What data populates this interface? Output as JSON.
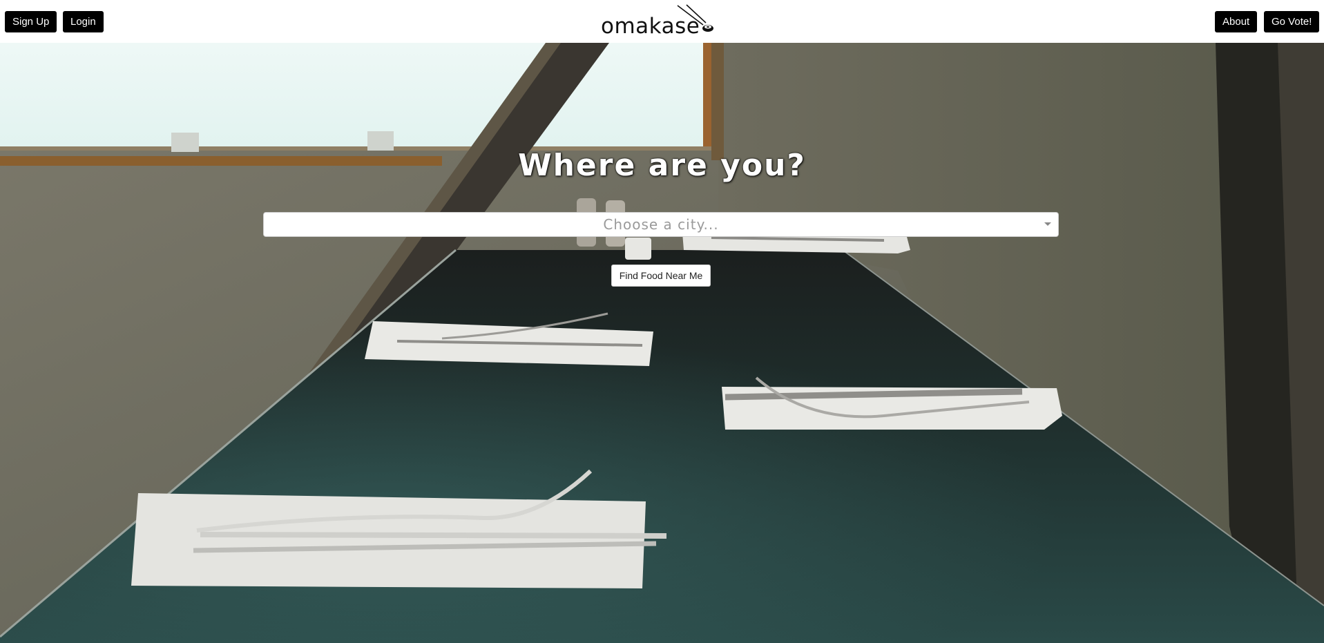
{
  "nav": {
    "signup_label": "Sign Up",
    "login_label": "Login",
    "about_label": "About",
    "vote_label": "Go Vote!"
  },
  "logo": {
    "text": "omakase",
    "icon": "chopsticks-sushi-icon"
  },
  "hero": {
    "headline": "Where are you?",
    "background": "restaurant-table-photo"
  },
  "search": {
    "placeholder": "Choose a city...",
    "selected_value": ""
  },
  "actions": {
    "find_label": "Find Food Near Me"
  },
  "colors": {
    "nav_button_bg": "#000000",
    "nav_button_text": "#ffffff",
    "navbar_bg": "#ffffff",
    "headline_text": "#ffffff",
    "placeholder_text": "#9a9a9a"
  }
}
